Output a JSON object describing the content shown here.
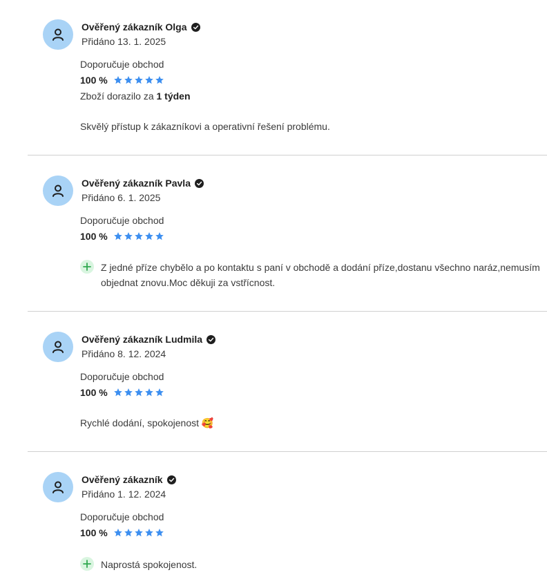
{
  "reviews": [
    {
      "author": "Ověřený zákazník Olga",
      "date": "Přidáno 13. 1. 2025",
      "recommend": "Doporučuje obchod",
      "rating": "100 %",
      "stars": 5,
      "delivery_prefix": "Zboží dorazilo za ",
      "delivery_value": "1 týden",
      "comment": "Skvělý přístup k zákazníkovi a operativní řešení problému."
    },
    {
      "author": "Ověřený zákazník Pavla",
      "date": "Přidáno 6. 1. 2025",
      "recommend": "Doporučuje obchod",
      "rating": "100 %",
      "stars": 5,
      "pro": "Z jedné příze chybělo a po kontaktu s paní v obchodě a dodání příze,dostanu všechno naráz,nemusím objednat znovu.Moc děkuji za vstřícnost."
    },
    {
      "author": "Ověřený zákazník Ludmila",
      "date": "Přidáno 8. 12. 2024",
      "recommend": "Doporučuje obchod",
      "rating": "100 %",
      "stars": 5,
      "comment": "Rychlé dodání, spokojenost 🥰"
    },
    {
      "author": "Ověřený zákazník",
      "date": "Přidáno 1. 12. 2024",
      "recommend": "Doporučuje obchod",
      "rating": "100 %",
      "stars": 5,
      "pro": "Naprostá spokojenost."
    }
  ],
  "colors": {
    "avatar_bg": "#a9d3f6",
    "star": "#3d8ff0",
    "plus_bg": "#d9f5e0",
    "plus": "#2fa84f",
    "divider": "#cfcfcf"
  },
  "icons": {
    "avatar": "user-icon",
    "verified": "verified-check-icon",
    "star": "star-icon",
    "pro": "plus-icon"
  }
}
